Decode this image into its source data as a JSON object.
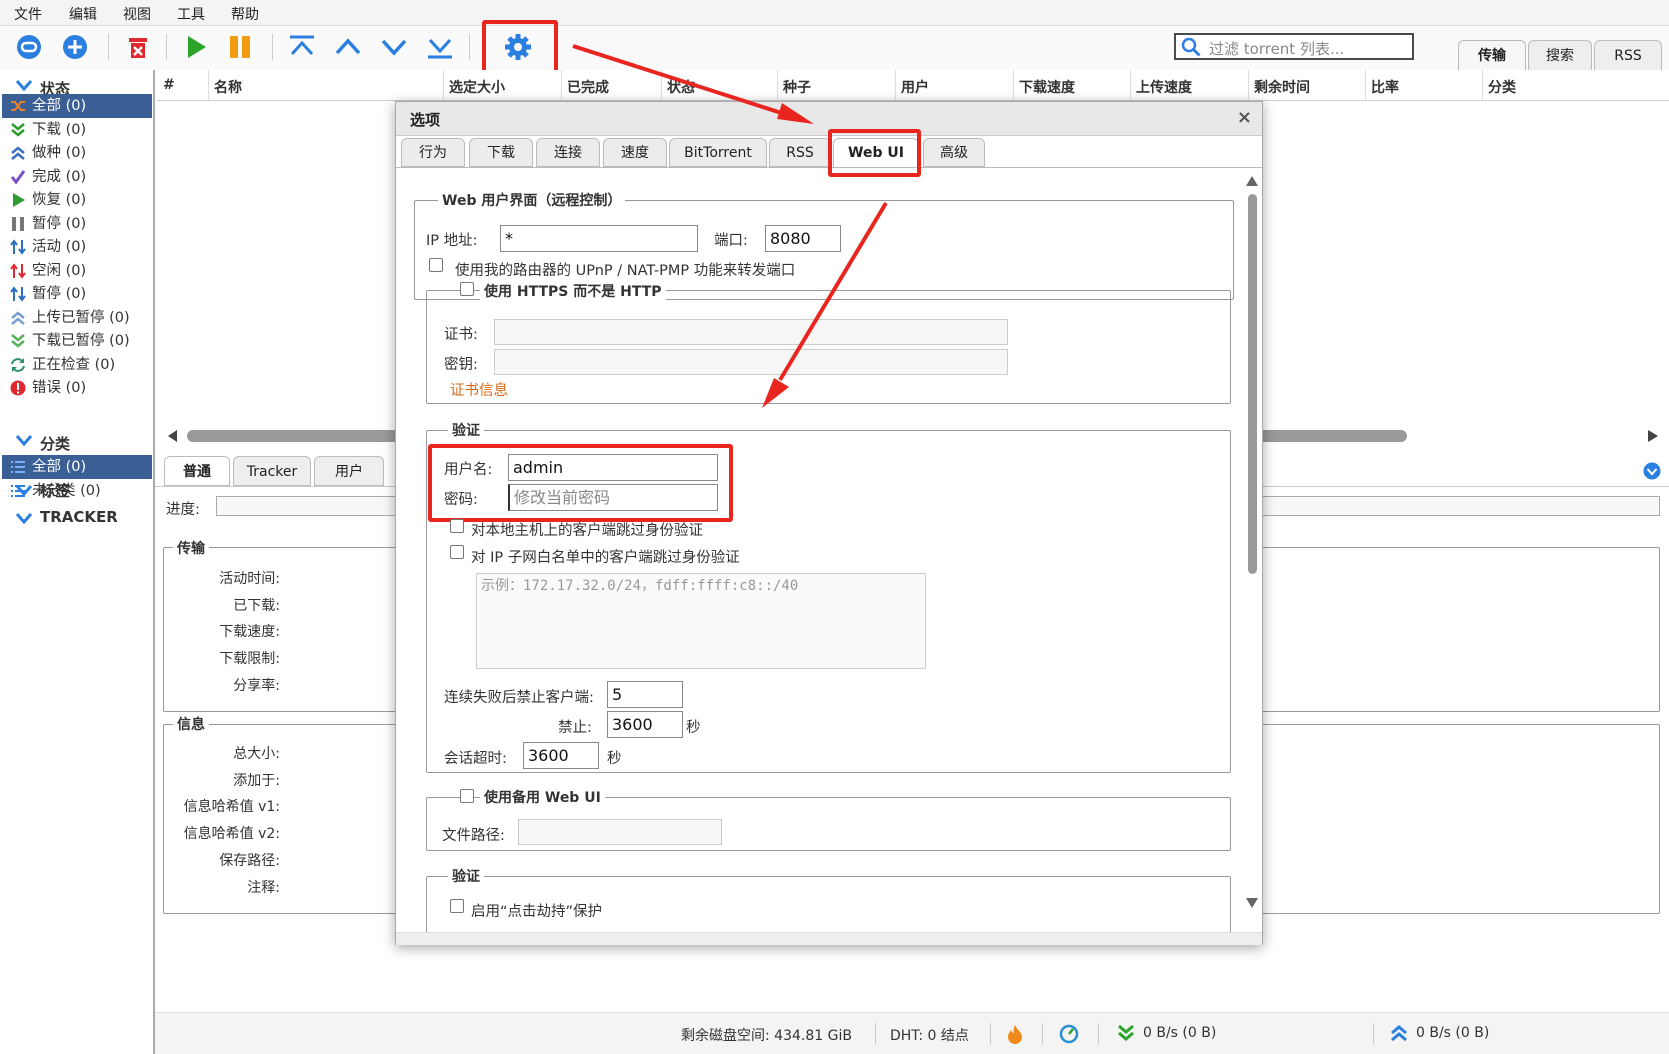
{
  "menu": [
    "文件",
    "编辑",
    "视图",
    "工具",
    "帮助"
  ],
  "search": {
    "placeholder": "过滤 torrent 列表..."
  },
  "right_tabs": [
    "传输",
    "搜索",
    "RSS"
  ],
  "sidebar": {
    "status_header": "状态",
    "status_items": [
      {
        "label": "全部 (0)",
        "icon": "shuffle-icon",
        "color": "#e8822a"
      },
      {
        "label": "下载 (0)",
        "icon": "download-icon",
        "color": "#2a9d2a"
      },
      {
        "label": "做种 (0)",
        "icon": "upload-icon",
        "color": "#3a6fc4"
      },
      {
        "label": "完成 (0)",
        "icon": "check-icon",
        "color": "#7a4fc4"
      },
      {
        "label": "恢复 (0)",
        "icon": "play-icon",
        "color": "#2a9d2a"
      },
      {
        "label": "暂停 (0)",
        "icon": "pause-icon",
        "color": "#777"
      },
      {
        "label": "活动 (0)",
        "icon": "active-icon",
        "color": "#2a6fc4"
      },
      {
        "label": "空闲 (0)",
        "icon": "idle-icon",
        "color": "#e0282f"
      },
      {
        "label": "暂停 (0)",
        "icon": "stalled-icon",
        "color": "#2a6fc4"
      },
      {
        "label": "上传已暂停 (0)",
        "icon": "upload-paused-icon",
        "color": "#7a9fd4"
      },
      {
        "label": "下载已暂停 (0)",
        "icon": "download-paused-icon",
        "color": "#5ab05a"
      },
      {
        "label": "正在检查 (0)",
        "icon": "refresh-icon",
        "color": "#2a8f6a"
      },
      {
        "label": "错误 (0)",
        "icon": "error-icon",
        "color": "#e0282f"
      }
    ],
    "category_header": "分类",
    "category_items": [
      "全部 (0)",
      "未分类 (0)"
    ],
    "tags_header": "标签",
    "tracker_header": "TRACKER"
  },
  "columns": [
    "#",
    "名称",
    "选定大小",
    "已完成",
    "状态",
    "种子",
    "用户",
    "下载速度",
    "上传速度",
    "剩余时间",
    "比率",
    "分类"
  ],
  "bottom_tabs": [
    "普通",
    "Tracker",
    "用户"
  ],
  "progress_label": "进度:",
  "transfer": {
    "legend": "传输",
    "rows": [
      "活动时间:",
      "已下载:",
      "下载速度:",
      "下载限制:",
      "分享率:"
    ]
  },
  "info": {
    "legend": "信息",
    "rows": [
      "总大小:",
      "添加于:",
      "信息哈希值 v1:",
      "信息哈希值 v2:",
      "保存路径:",
      "注释:"
    ]
  },
  "status": {
    "disk": "剩余磁盘空间: 434.81 GiB",
    "dht": "DHT: 0 结点",
    "down": "0 B/s (0 B)",
    "up": "0 B/s (0 B)"
  },
  "dialog": {
    "title": "选项",
    "close": "×",
    "tabs": [
      "行为",
      "下载",
      "连接",
      "速度",
      "BitTorrent",
      "RSS",
      "Web UI",
      "高级"
    ],
    "active_tab": "Web UI",
    "webui_legend": "Web 用户界面（远程控制）",
    "ip_label": "IP 地址:",
    "ip_value": "*",
    "port_label": "端口:",
    "port_value": "8080",
    "upnp_label": "使用我的路由器的 UPnP / NAT-PMP 功能来转发端口",
    "https_legend": "使用 HTTPS 而不是 HTTP",
    "cert_label": "证书:",
    "key_label": "密钥:",
    "cert_info": "证书信息",
    "auth_legend": "验证",
    "user_label": "用户名:",
    "user_value": "admin",
    "pass_label": "密码:",
    "pass_placeholder": "修改当前密码",
    "localhost_label": "对本地主机上的客户端跳过身份验证",
    "subnet_label": "对 IP 子网白名单中的客户端跳过身份验证",
    "subnet_placeholder": "示例：172.17.32.0/24，fdff:ffff:c8::/40",
    "ban_after_label": "连续失败后禁止客户端:",
    "ban_after_value": "5",
    "ban_label": "禁止:",
    "ban_value": "3600",
    "ban_unit": "秒",
    "session_label": "会话超时:",
    "session_value": "3600",
    "session_unit": "秒",
    "alt_legend": "使用备用 Web UI",
    "path_label": "文件路径:",
    "auth2_legend": "验证",
    "clickjack_label": "启用“点击劫持”保护"
  },
  "colors": {
    "accent": "#3a5f95",
    "annotation": "#e8261f",
    "toolbar_blue": "#2a7fe0",
    "green": "#2aa52a",
    "orange": "#f39c12",
    "red": "#e0282f"
  }
}
